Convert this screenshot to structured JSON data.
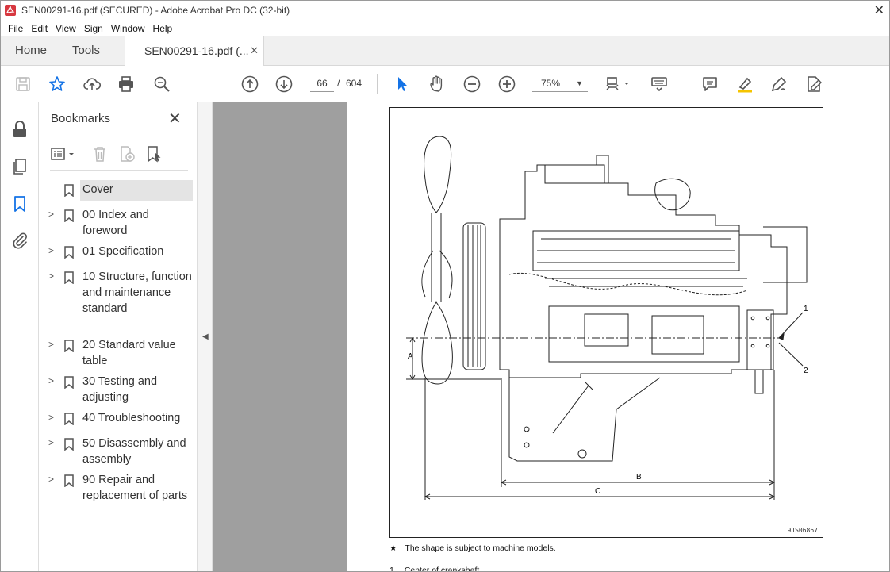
{
  "window": {
    "title": "SEN00291-16.pdf (SECURED) - Adobe Acrobat Pro DC (32-bit)"
  },
  "menu": [
    "File",
    "Edit",
    "View",
    "Sign",
    "Window",
    "Help"
  ],
  "tabs": {
    "home": "Home",
    "tools": "Tools",
    "document": "SEN00291-16.pdf (...",
    "close_glyph": "✕"
  },
  "toolbar": {
    "current_page": "66",
    "separator": "/",
    "total_pages": "604",
    "zoom": "75%"
  },
  "bookmarks": {
    "header": "Bookmarks",
    "items": [
      {
        "label": "Cover",
        "expandable": false,
        "selected": true
      },
      {
        "label": "00 Index and foreword",
        "expandable": true
      },
      {
        "label": "01 Specification",
        "expandable": true
      },
      {
        "label": "10 Structure, function and maintenance standard",
        "expandable": true
      },
      {
        "label": "20 Standard value table",
        "expandable": true
      },
      {
        "label": "30 Testing and adjusting",
        "expandable": true
      },
      {
        "label": "40 Troubleshooting",
        "expandable": true
      },
      {
        "label": "50 Disassembly and assembly",
        "expandable": true
      },
      {
        "label": "90 Repair and replacement of parts",
        "expandable": true
      }
    ]
  },
  "document": {
    "figure_labels": {
      "a": "A",
      "b": "B",
      "c": "C",
      "callout_1": "1",
      "callout_2": "2"
    },
    "figure_code": "9JS06867",
    "note_star": "★",
    "note_text": "The shape is subject to machine models.",
    "partial_num": "1.",
    "partial_text": "Center of crankshaft"
  },
  "colors": {
    "accent_blue": "#1473e6",
    "acrobat_red": "#d7373f"
  }
}
